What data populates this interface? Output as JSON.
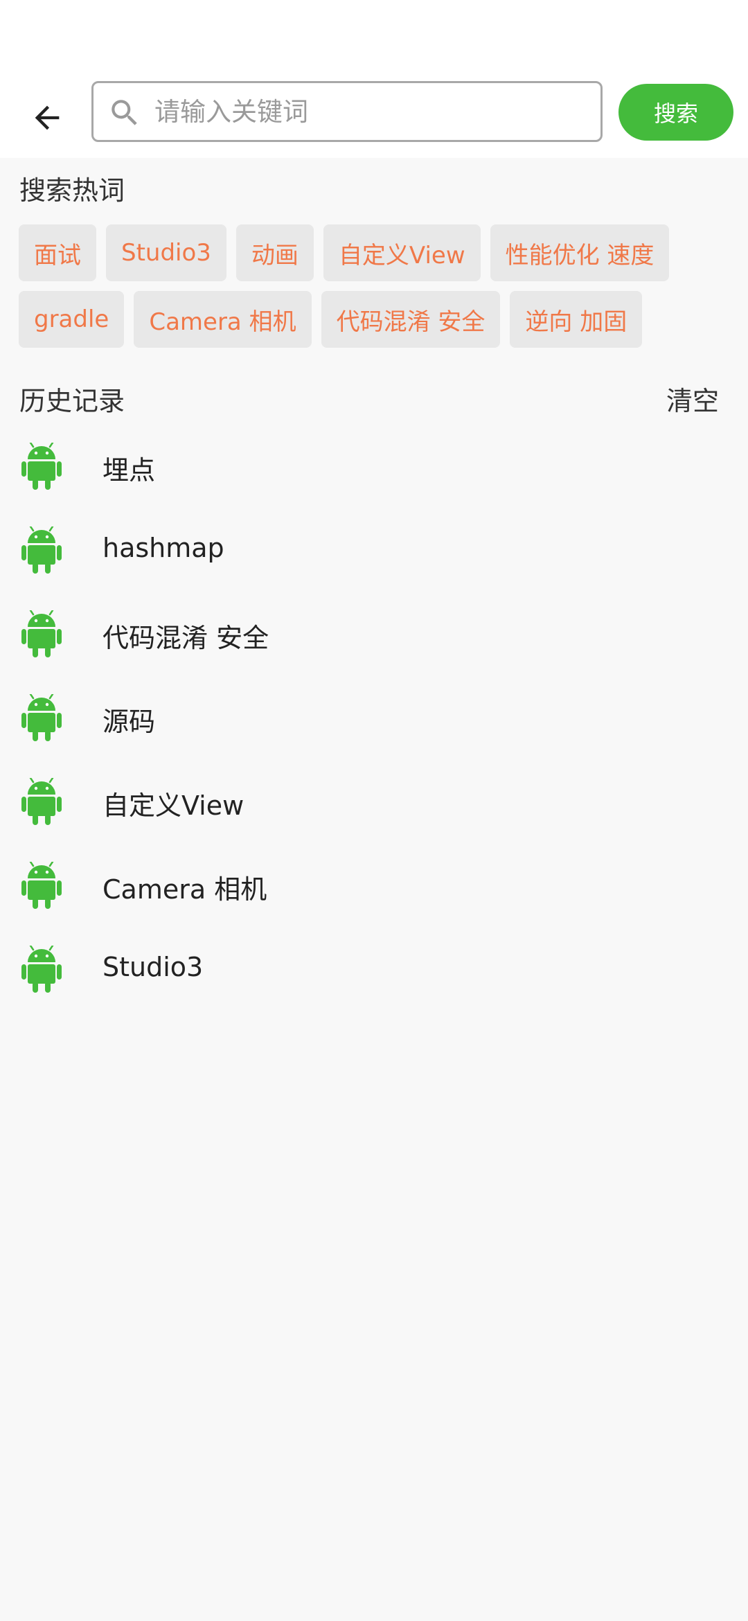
{
  "header": {
    "search_placeholder": "请输入关键词",
    "search_button_label": "搜索"
  },
  "hot": {
    "title": "搜索热词",
    "tags": [
      "面试",
      "Studio3",
      "动画",
      "自定义View",
      "性能优化 速度",
      "gradle",
      "Camera 相机",
      "代码混淆 安全",
      "逆向 加固"
    ]
  },
  "history": {
    "title": "历史记录",
    "clear_label": "清空",
    "items": [
      "埋点",
      "hashmap",
      "代码混淆 安全",
      "源码",
      "自定义View",
      "Camera 相机",
      "Studio3"
    ]
  },
  "colors": {
    "accent": "#44bb3c",
    "tag_text": "#f07848",
    "tag_bg": "#e8e8e8",
    "android_icon": "#44bb3c"
  },
  "icons": {
    "back": "arrow-left-icon",
    "search": "search-icon",
    "history_item": "android-icon"
  }
}
